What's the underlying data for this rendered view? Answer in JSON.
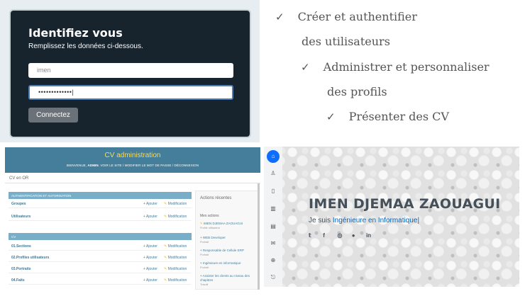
{
  "login": {
    "title": "Identifiez vous",
    "subtitle": "Remplissez les données ci-dessous.",
    "username_value": "imen",
    "password_value": "•••••••••••••|",
    "submit_label": "Connectez"
  },
  "features": [
    {
      "check": "✓",
      "text": "Créer et authentifier"
    },
    {
      "text": "des utilisateurs"
    },
    {
      "check": "✓",
      "text": "Administrer et personnaliser"
    },
    {
      "text": "des profils"
    },
    {
      "check": "✓",
      "text": "Présenter des CV"
    }
  ],
  "admin": {
    "title": "CV administration",
    "links": {
      "welcome": "BIENVENUE,",
      "user": "ADMIN",
      "rest": ". VOIR LE SITE / MODIFIER LE MOT DE PASSE / DÉCONNEXION"
    },
    "breadcrumb": "CV en OR",
    "auth_caption": "AUTHENTIFICATION ET AUTORISATION",
    "auth_rows": [
      "Groupes",
      "Utilisateurs"
    ],
    "cv_caption": "CV",
    "cv_rows": [
      "01.Sections",
      "02.Profiles utilisateurs",
      "03.Portraits",
      "04.Faits"
    ],
    "add_label": "Ajouter",
    "change_label": "Modification",
    "recent_title": "Actions récentes",
    "recent_sub": "Mes actions",
    "recent": [
      {
        "name": "IMEN DJEMAA ZAOUAGUI",
        "kind": "Profile utilisateur"
      },
      {
        "name": "WEB Developer",
        "kind": "Portrait"
      },
      {
        "name": "Responsable de Cellule ERP",
        "kind": "Portrait"
      },
      {
        "name": "Ingénieure en informatique",
        "kind": "Portrait"
      },
      {
        "name": "Assister les clients au niveau des chapitres",
        "kind": "Travail"
      }
    ]
  },
  "profile": {
    "name": "IMEN DJEMAA ZAOUAGUI",
    "tag_prefix": "Je suis ",
    "role": "Ingénieure en Informatique",
    "caret": "|",
    "nav_icons": [
      "home-icon",
      "user-icon",
      "file-icon",
      "book-icon",
      "server-icon",
      "envelope-icon",
      "lock-icon",
      "logout-icon"
    ],
    "socials": [
      "twitter-icon",
      "facebook-icon",
      "instagram-icon",
      "github-icon",
      "linkedin-icon"
    ]
  },
  "colors": {
    "login_bg": "#17232d",
    "admin_header": "#447e9b",
    "admin_title": "#f5dd5d",
    "admin_caption": "#79aec8",
    "accent_blue": "#0563bb"
  }
}
